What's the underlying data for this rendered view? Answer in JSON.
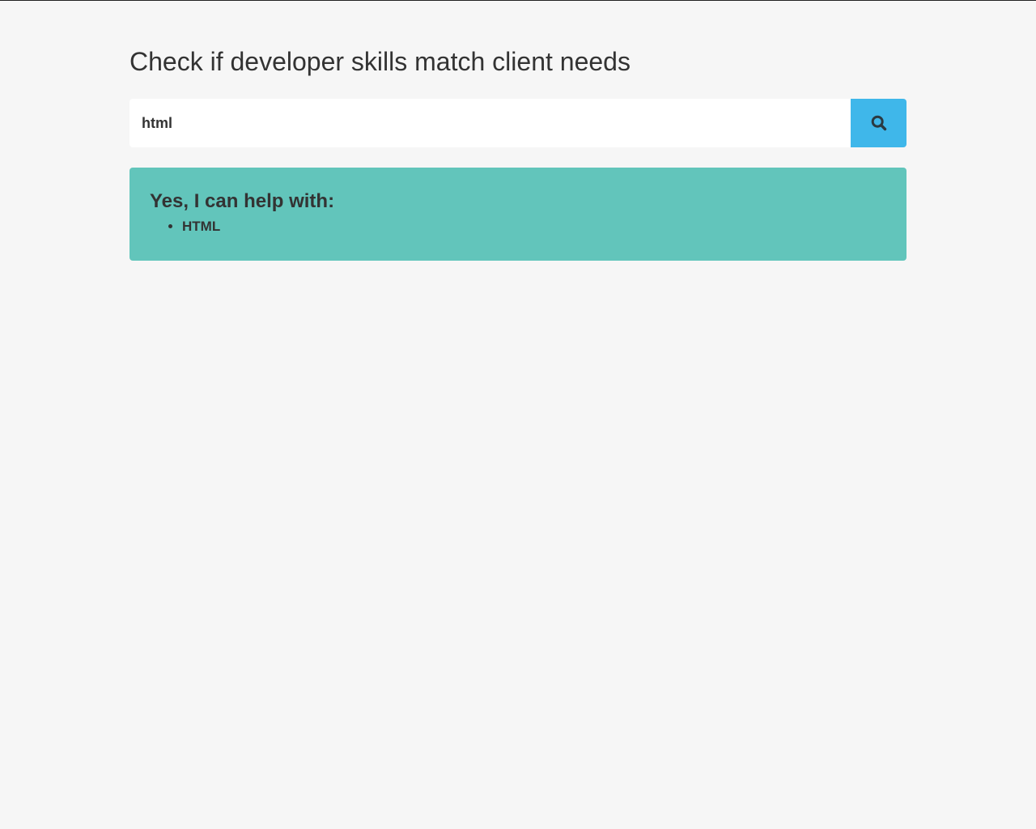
{
  "page": {
    "title": "Check if developer skills match client needs"
  },
  "search": {
    "value": "html",
    "button_icon": "search-icon"
  },
  "result": {
    "heading": "Yes, I can help with:",
    "items": [
      "HTML"
    ]
  },
  "colors": {
    "background": "#f6f6f6",
    "search_button": "#3fb7ea",
    "result_box": "#62c5bb",
    "text": "#333333"
  }
}
